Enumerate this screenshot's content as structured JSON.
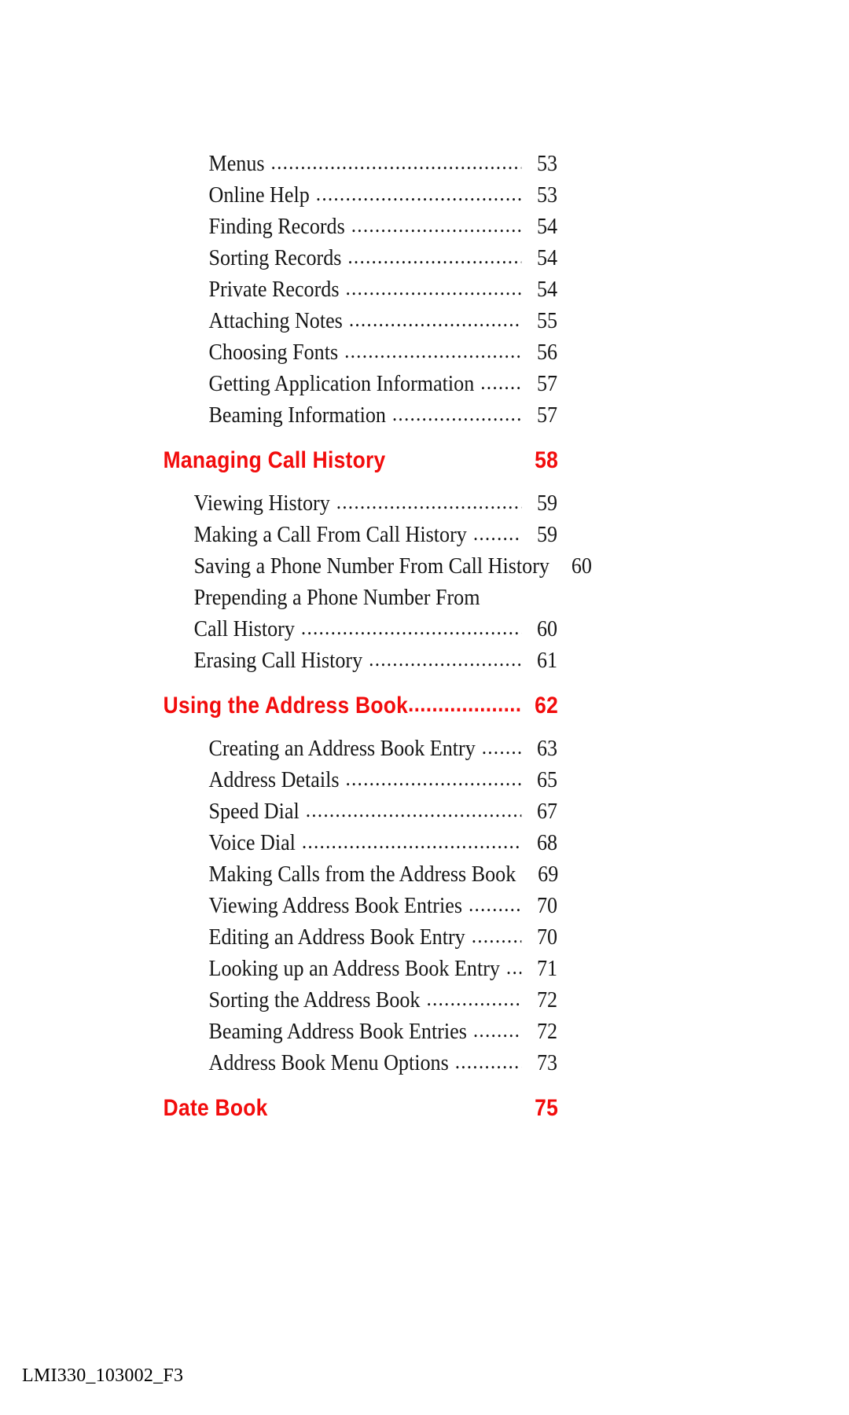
{
  "colors": {
    "heading_red": "#F20C0C",
    "body_text": "#161616",
    "page_background": "#FFFFFF"
  },
  "document": {
    "type": "table-of-contents",
    "footer_code": "LMI330_103002_F3"
  },
  "toc": {
    "blocks": [
      {
        "kind": "entries",
        "indent": "a",
        "items": [
          {
            "label": "Menus",
            "page": "53"
          },
          {
            "label": "Online Help",
            "page": "53"
          },
          {
            "label": "Finding Records",
            "page": "54"
          },
          {
            "label": "Sorting Records",
            "page": "54"
          },
          {
            "label": "Private Records",
            "page": "54"
          },
          {
            "label": "Attaching Notes",
            "page": "55"
          },
          {
            "label": "Choosing Fonts",
            "page": "56"
          },
          {
            "label": "Getting Application Information",
            "page": "57"
          },
          {
            "label": "Beaming Information",
            "page": "57"
          }
        ]
      },
      {
        "kind": "heading",
        "style": "plain",
        "label": "Managing Call History",
        "page": "58"
      },
      {
        "kind": "entries",
        "indent": "b",
        "items": [
          {
            "label": "Viewing History",
            "page": "59"
          },
          {
            "label": "Making a Call From Call History",
            "page": "59"
          },
          {
            "label": "Saving a Phone Number From Call History",
            "page": "60"
          },
          {
            "label": "Prepending a Phone Number From",
            "page": "",
            "wrapped": true
          },
          {
            "label": "Call History",
            "page": "60"
          },
          {
            "label": "Erasing Call History",
            "page": "61"
          }
        ]
      },
      {
        "kind": "heading",
        "style": "dots",
        "label": "Using the Address Book",
        "page": "62"
      },
      {
        "kind": "entries",
        "indent": "a",
        "items": [
          {
            "label": "Creating an Address Book Entry",
            "page": "63"
          },
          {
            "label": "Address Details",
            "page": "65"
          },
          {
            "label": "Speed Dial",
            "page": "67"
          },
          {
            "label": "Voice Dial",
            "page": "68"
          },
          {
            "label": "Making Calls from the Address Book",
            "page": "69"
          },
          {
            "label": "Viewing Address Book Entries",
            "page": "70"
          },
          {
            "label": "Editing an Address Book Entry",
            "page": "70"
          },
          {
            "label": "Looking up an Address Book Entry",
            "page": "71"
          },
          {
            "label": "Sorting the Address Book",
            "page": "72"
          },
          {
            "label": "Beaming Address Book Entries",
            "page": "72"
          },
          {
            "label": "Address Book Menu Options",
            "page": "73"
          }
        ]
      },
      {
        "kind": "heading",
        "style": "plain",
        "label": "Date Book",
        "page": "75"
      }
    ]
  }
}
